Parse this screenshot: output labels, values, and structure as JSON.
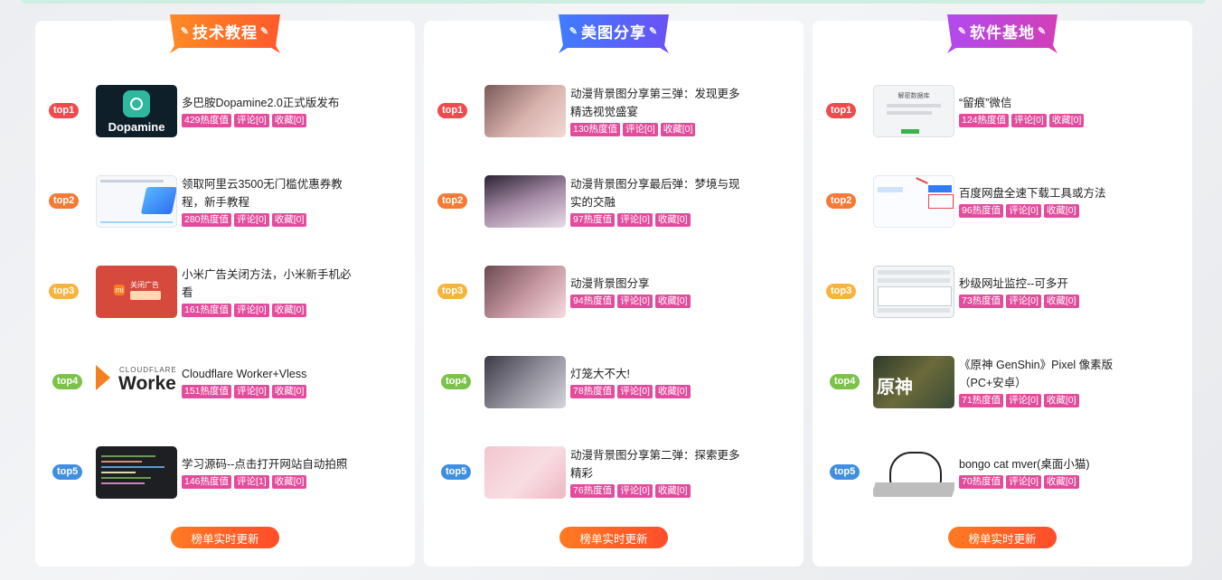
{
  "panels": [
    {
      "title": "技术教程",
      "button": "榜单实时更新",
      "items": [
        {
          "rank": "top1",
          "title": "多巴胺Dopamine2.0正式版发布",
          "heat": "429热度值",
          "comment": "评论[0]",
          "fav": "收藏[0]",
          "thumb_text": "Dopamine"
        },
        {
          "rank": "top2",
          "title": "领取阿里云3500无门槛优惠券教程，新手教程",
          "heat": "280热度值",
          "comment": "评论[0]",
          "fav": "收藏[0]"
        },
        {
          "rank": "top3",
          "title": "小米广告关闭方法，小米新手机必看",
          "heat": "161热度值",
          "comment": "评论[0]",
          "fav": "收藏[0]",
          "thumb_text": "关闭广告"
        },
        {
          "rank": "top4",
          "title": "Cloudflare Worker+Vless",
          "heat": "151热度值",
          "comment": "评论[0]",
          "fav": "收藏[0]",
          "thumb_text": "Worke",
          "thumb_sub": "CLOUDFLARE"
        },
        {
          "rank": "top5",
          "title": "学习源码--点击打开网站自动拍照",
          "heat": "146热度值",
          "comment": "评论[1]",
          "fav": "收藏[0]"
        }
      ]
    },
    {
      "title": "美图分享",
      "button": "榜单实时更新",
      "items": [
        {
          "rank": "top1",
          "title": "动漫背景图分享第三弹：发现更多精选视觉盛宴",
          "heat": "130热度值",
          "comment": "评论[0]",
          "fav": "收藏[0]"
        },
        {
          "rank": "top2",
          "title": "动漫背景图分享最后弹：梦境与现实的交融",
          "heat": "97热度值",
          "comment": "评论[0]",
          "fav": "收藏[0]"
        },
        {
          "rank": "top3",
          "title": "动漫背景图分享",
          "heat": "94热度值",
          "comment": "评论[0]",
          "fav": "收藏[0]"
        },
        {
          "rank": "top4",
          "title": "灯笼大不大!",
          "heat": "78热度值",
          "comment": "评论[0]",
          "fav": "收藏[0]"
        },
        {
          "rank": "top5",
          "title": "动漫背景图分享第二弹：探索更多精彩",
          "heat": "76热度值",
          "comment": "评论[0]",
          "fav": "收藏[0]"
        }
      ]
    },
    {
      "title": "软件基地",
      "button": "榜单实时更新",
      "items": [
        {
          "rank": "top1",
          "title": "“留痕”微信",
          "heat": "124热度值",
          "comment": "评论[0]",
          "fav": "收藏[0]",
          "thumb_text": "解密数据库"
        },
        {
          "rank": "top2",
          "title": "百度网盘全速下载工具或方法",
          "heat": "96热度值",
          "comment": "评论[0]",
          "fav": "收藏[0]"
        },
        {
          "rank": "top3",
          "title": "秒级网址监控--可多开",
          "heat": "73热度值",
          "comment": "评论[0]",
          "fav": "收藏[0]"
        },
        {
          "rank": "top4",
          "title": "《原神 GenShin》Pixel 像素版（PC+安卓）",
          "heat": "71热度值",
          "comment": "评论[0]",
          "fav": "收藏[0]",
          "thumb_text": "原神"
        },
        {
          "rank": "top5",
          "title": "bongo cat mver(桌面小猫)",
          "heat": "70热度值",
          "comment": "评论[0]",
          "fav": "收藏[0]"
        }
      ]
    }
  ],
  "colors": {
    "tag": "#e34c9c",
    "button": "#ff5a2a"
  }
}
